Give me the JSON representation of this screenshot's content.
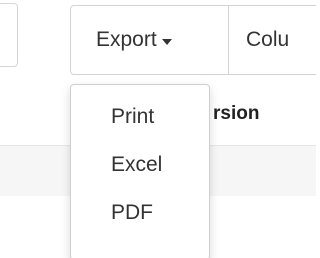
{
  "toolbar": {
    "export_label": "Export",
    "columns_label": "Colu"
  },
  "table": {
    "header_visible_text": "rsion"
  },
  "export_menu": {
    "items": [
      {
        "label": "Print"
      },
      {
        "label": "Excel"
      },
      {
        "label": "PDF"
      }
    ]
  },
  "colors": {
    "border": "#d3d3d3",
    "text": "#333333",
    "striped_row": "#f6f6f6"
  },
  "icons": {
    "export_caret": "caret-down-icon"
  }
}
